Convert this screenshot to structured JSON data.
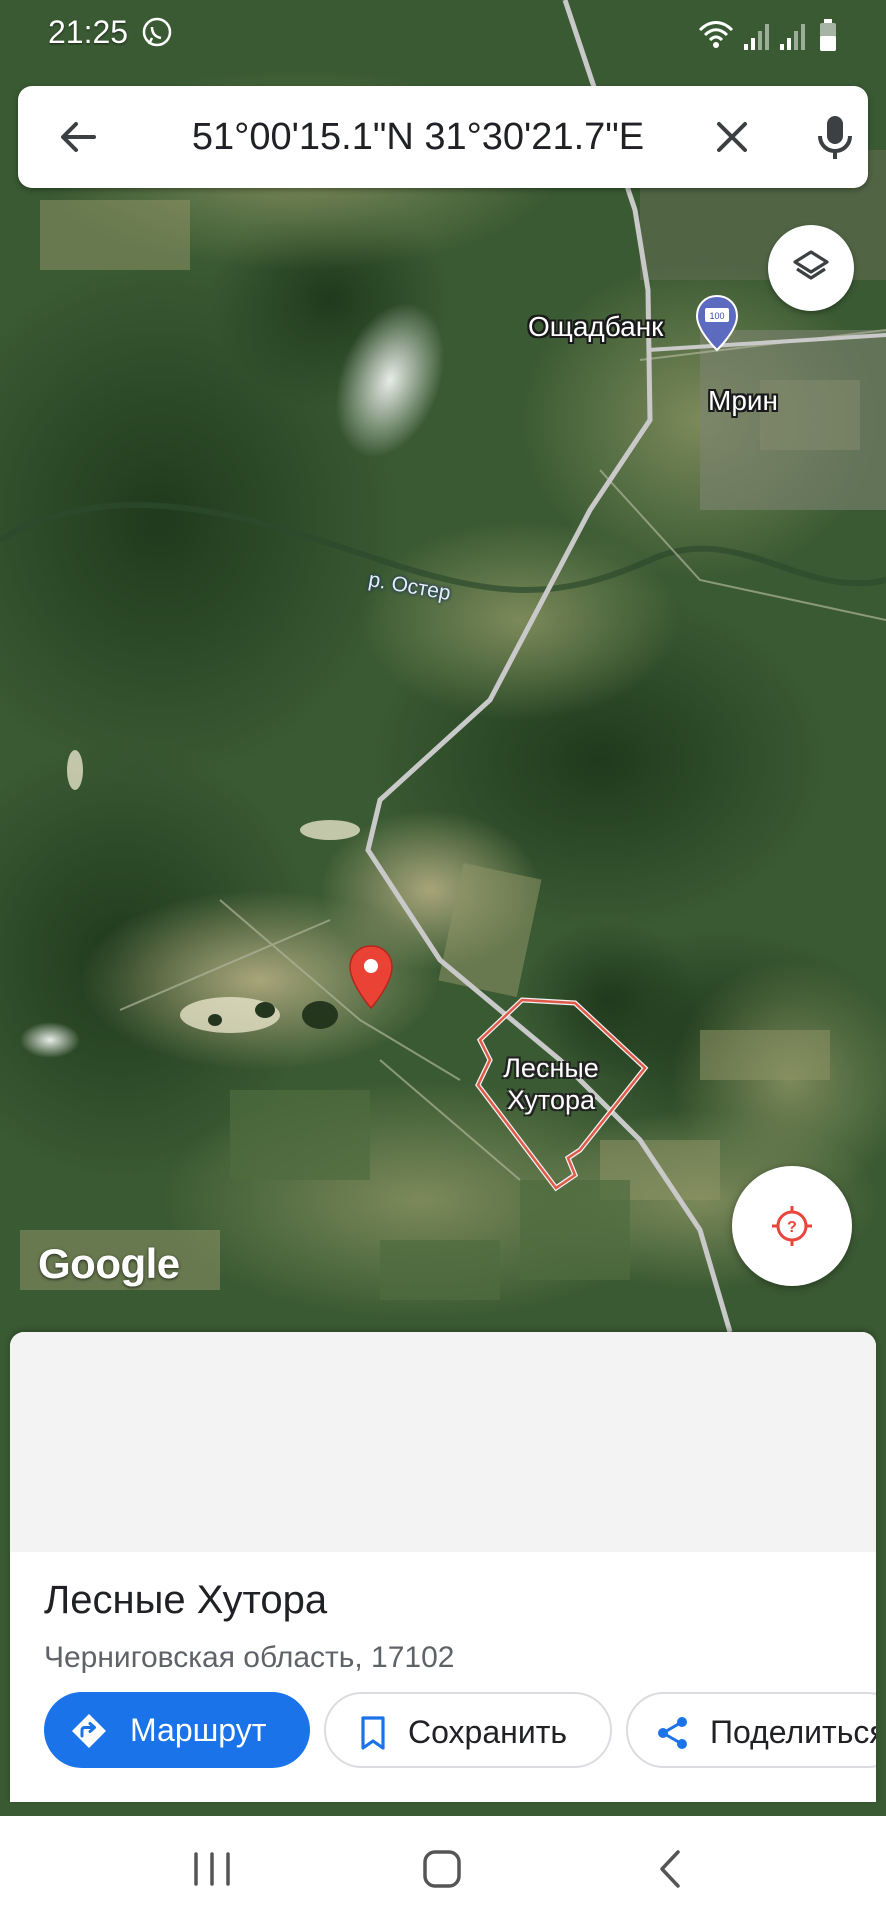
{
  "status_bar": {
    "time": "21:25",
    "icons": [
      "viber-icon",
      "wifi-icon",
      "signal-icon",
      "signal-icon",
      "battery-icon"
    ]
  },
  "search": {
    "query": "51°00'15.1\"N 31°30'21.7\"E",
    "icons": [
      "back-arrow-icon",
      "close-icon",
      "mic-icon"
    ]
  },
  "map": {
    "type": "satellite",
    "labels": {
      "bank": "Ощадбанк",
      "town": "Мрин",
      "river": "р. Остер",
      "area": "Лесные Хутора"
    },
    "logo": "Google",
    "icons": [
      "layers-icon",
      "locate-icon",
      "map-pin-icon",
      "bank-poi-icon"
    ],
    "colors": {
      "pin": "#ea4335",
      "area_outline": "#e05a4a",
      "road": "#c9c9c9"
    }
  },
  "place": {
    "title": "Лесные Хутора",
    "address": "Черниговская область, 17102"
  },
  "actions": {
    "route": "Маршрут",
    "save": "Сохранить",
    "share": "Поделиться"
  },
  "colors": {
    "accent": "#1a73e8",
    "text_primary": "#202124",
    "text_secondary": "#5f6368"
  },
  "nav_bar": {
    "icons": [
      "recent-apps-icon",
      "home-icon",
      "back-icon"
    ]
  }
}
